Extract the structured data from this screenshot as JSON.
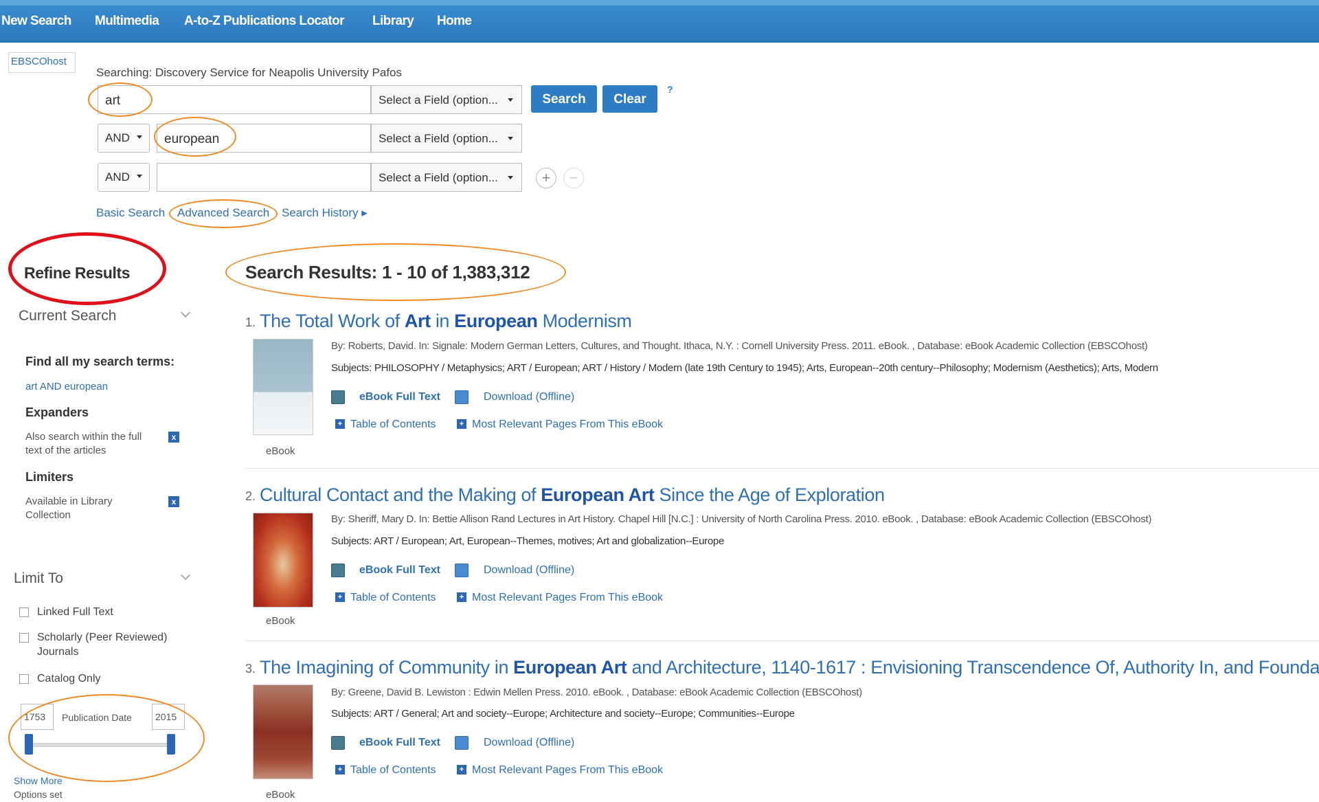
{
  "nav": {
    "items": [
      "New Search",
      "Multimedia",
      "A-to-Z Publications Locator",
      "Library",
      "Home"
    ]
  },
  "logo": {
    "text": "EBSCOhost"
  },
  "search": {
    "searching_label": "Searching: Discovery Service for Neapolis University Pafos",
    "rows": [
      {
        "bool": "",
        "value": "art",
        "field": "Select a Field (option..."
      },
      {
        "bool": "AND",
        "value": "european",
        "field": "Select a Field (option..."
      },
      {
        "bool": "AND",
        "value": "",
        "field": "Select a Field (option..."
      }
    ],
    "search_button": "Search",
    "clear_button": "Clear",
    "help": "?",
    "add": "+",
    "remove": "−",
    "links": {
      "basic": "Basic Search",
      "advanced": "Advanced Search",
      "history": "Search History ▸"
    }
  },
  "sidebar": {
    "refine_title": "Refine Results",
    "current_search": "Current Search",
    "find_all": "Find all my search terms:",
    "terms": "art AND european",
    "expanders": "Expanders",
    "expander_item": "Also search within the full text of the articles",
    "limiters": "Limiters",
    "limiter_item": "Available in Library Collection",
    "limit_to": "Limit To",
    "checkboxes": [
      "Linked Full Text",
      "Scholarly (Peer Reviewed) Journals",
      "Catalog Only"
    ],
    "date_from": "1753",
    "date_label": "Publication Date",
    "date_to": "2015",
    "show_more": "Show More",
    "options_set": "Options set"
  },
  "results": {
    "heading": "Search Results: 1 - 10 of 1,383,312",
    "items": [
      {
        "num": "1.",
        "title_parts": [
          "The Total Work of ",
          "Art",
          " in ",
          "European",
          " Modernism"
        ],
        "byline": "By: Roberts, David. In: Signale: Modern German Letters, Cultures, and Thought. Ithaca, N.Y. : Cornell University Press. 2011. eBook. , Database: eBook Academic Collection (EBSCOhost)",
        "subjects": "Subjects: PHILOSOPHY / Metaphysics; ART / European; ART / History / Modern (late 19th Century to 1945); Arts, European--20th century--Philosophy; Modernism (Aesthetics); Arts, Modern",
        "type": "eBook"
      },
      {
        "num": "2.",
        "title_parts": [
          "Cultural Contact and the Making of ",
          "European Art",
          " Since the Age of Exploration"
        ],
        "byline": "By: Sheriff, Mary D.  In: Bettie Allison Rand Lectures in Art History. Chapel Hill [N.C.] : University of North Carolina Press. 2010. eBook. , Database: eBook Academic Collection (EBSCOhost)",
        "subjects": "Subjects: ART / European; Art, European--Themes, motives; Art and globalization--Europe",
        "type": "eBook"
      },
      {
        "num": "3.",
        "title_parts": [
          "The Imagining of Community in ",
          "European Art",
          " and Architecture, 1140-1617 : Envisioning Transcendence Of, Authority In, and Foundations"
        ],
        "byline": "By: Greene, David B. Lewiston : Edwin Mellen Press. 2010. eBook. , Database: eBook Academic Collection (EBSCOhost)",
        "subjects": "Subjects: ART / General; Art and society--Europe; Architecture and society--Europe; Communities--Europe",
        "type": "eBook"
      }
    ],
    "actions": {
      "fulltext": "eBook Full Text",
      "download": "Download (Offline)",
      "toc": "Table of Contents",
      "relevant": "Most Relevant Pages From This eBook"
    }
  },
  "colors": {
    "nav_bg": "#2c78bd",
    "link": "#2f6fb3",
    "annotation_orange": "#f08a24",
    "annotation_red": "#e0101a"
  }
}
